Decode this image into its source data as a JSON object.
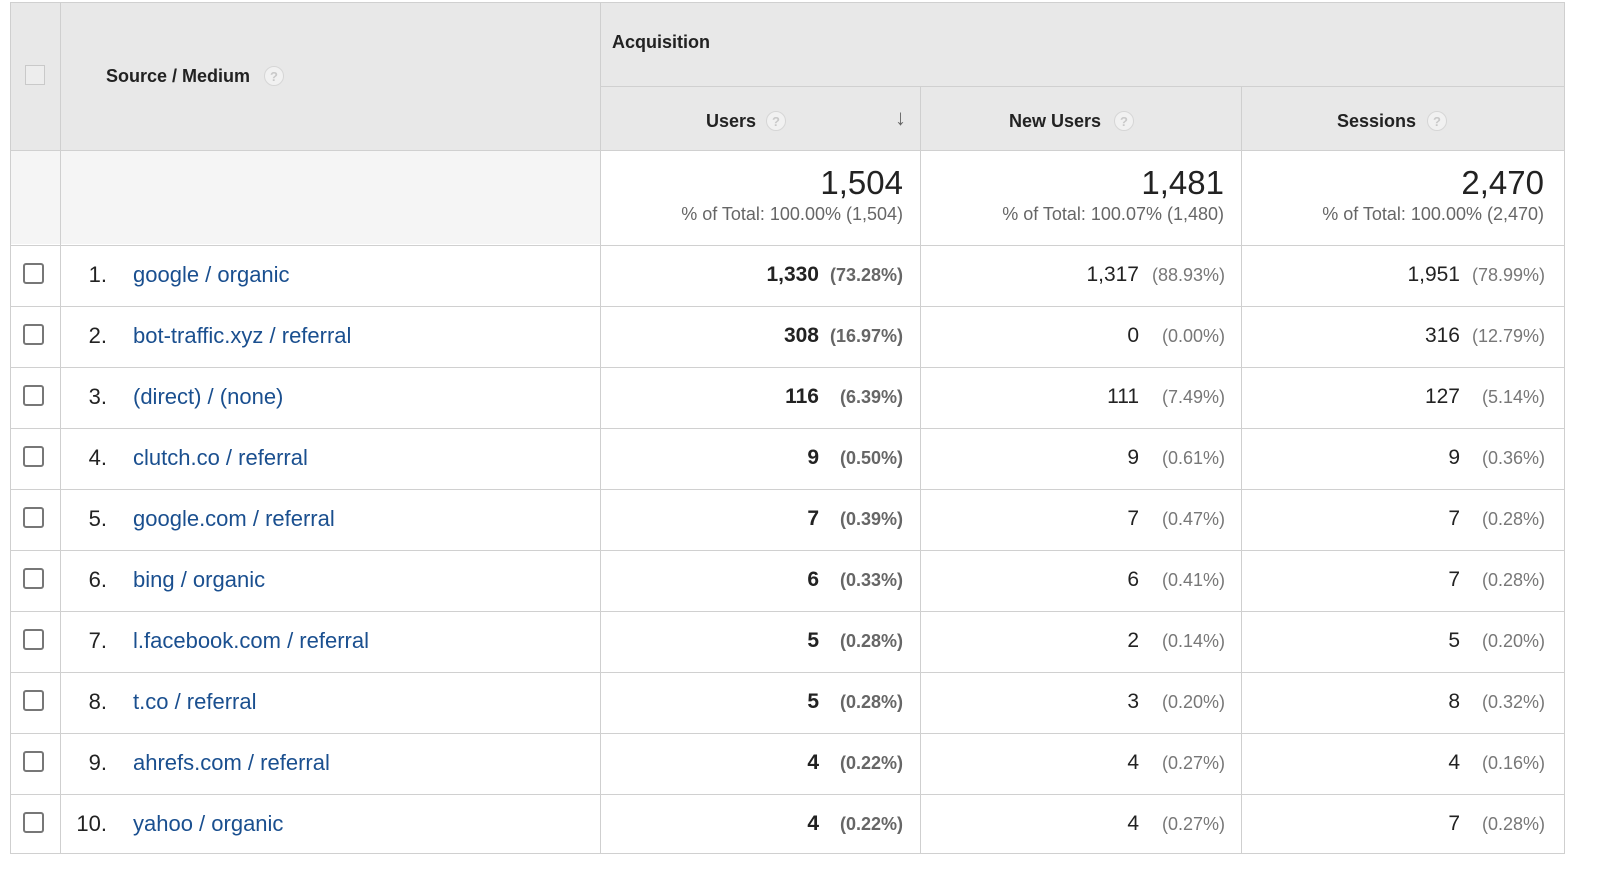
{
  "header": {
    "dimension_label": "Source / Medium",
    "group_label": "Acquisition",
    "columns": [
      {
        "label": "Users"
      },
      {
        "label": "New Users"
      },
      {
        "label": "Sessions"
      }
    ],
    "help_glyph": "?",
    "sort_glyph": "↓"
  },
  "totals": [
    {
      "value": "1,504",
      "sub": "% of Total: 100.00% (1,504)"
    },
    {
      "value": "1,481",
      "sub": "% of Total: 100.07% (1,480)"
    },
    {
      "value": "2,470",
      "sub": "% of Total: 100.00% (2,470)"
    }
  ],
  "rows": [
    {
      "index": "1.",
      "source": "google / organic",
      "users": "1,330",
      "users_pct": "(73.28%)",
      "new_users": "1,317",
      "new_users_pct": "(88.93%)",
      "sessions": "1,951",
      "sessions_pct": "(78.99%)"
    },
    {
      "index": "2.",
      "source": "bot-traffic.xyz / referral",
      "users": "308",
      "users_pct": "(16.97%)",
      "new_users": "0",
      "new_users_pct": "(0.00%)",
      "sessions": "316",
      "sessions_pct": "(12.79%)"
    },
    {
      "index": "3.",
      "source": "(direct) / (none)",
      "users": "116",
      "users_pct": "(6.39%)",
      "new_users": "111",
      "new_users_pct": "(7.49%)",
      "sessions": "127",
      "sessions_pct": "(5.14%)"
    },
    {
      "index": "4.",
      "source": "clutch.co / referral",
      "users": "9",
      "users_pct": "(0.50%)",
      "new_users": "9",
      "new_users_pct": "(0.61%)",
      "sessions": "9",
      "sessions_pct": "(0.36%)"
    },
    {
      "index": "5.",
      "source": "google.com / referral",
      "users": "7",
      "users_pct": "(0.39%)",
      "new_users": "7",
      "new_users_pct": "(0.47%)",
      "sessions": "7",
      "sessions_pct": "(0.28%)"
    },
    {
      "index": "6.",
      "source": "bing / organic",
      "users": "6",
      "users_pct": "(0.33%)",
      "new_users": "6",
      "new_users_pct": "(0.41%)",
      "sessions": "7",
      "sessions_pct": "(0.28%)"
    },
    {
      "index": "7.",
      "source": "l.facebook.com / referral",
      "users": "5",
      "users_pct": "(0.28%)",
      "new_users": "2",
      "new_users_pct": "(0.14%)",
      "sessions": "5",
      "sessions_pct": "(0.20%)"
    },
    {
      "index": "8.",
      "source": "t.co / referral",
      "users": "5",
      "users_pct": "(0.28%)",
      "new_users": "3",
      "new_users_pct": "(0.20%)",
      "sessions": "8",
      "sessions_pct": "(0.32%)"
    },
    {
      "index": "9.",
      "source": "ahrefs.com / referral",
      "users": "4",
      "users_pct": "(0.22%)",
      "new_users": "4",
      "new_users_pct": "(0.27%)",
      "sessions": "4",
      "sessions_pct": "(0.16%)"
    },
    {
      "index": "10.",
      "source": "yahoo / organic",
      "users": "4",
      "users_pct": "(0.22%)",
      "new_users": "4",
      "new_users_pct": "(0.27%)",
      "sessions": "7",
      "sessions_pct": "(0.28%)"
    }
  ],
  "colors": {
    "link": "#1a4f8f",
    "header_bg": "#e8e8e8",
    "totals_bg": "#f5f5f5"
  }
}
